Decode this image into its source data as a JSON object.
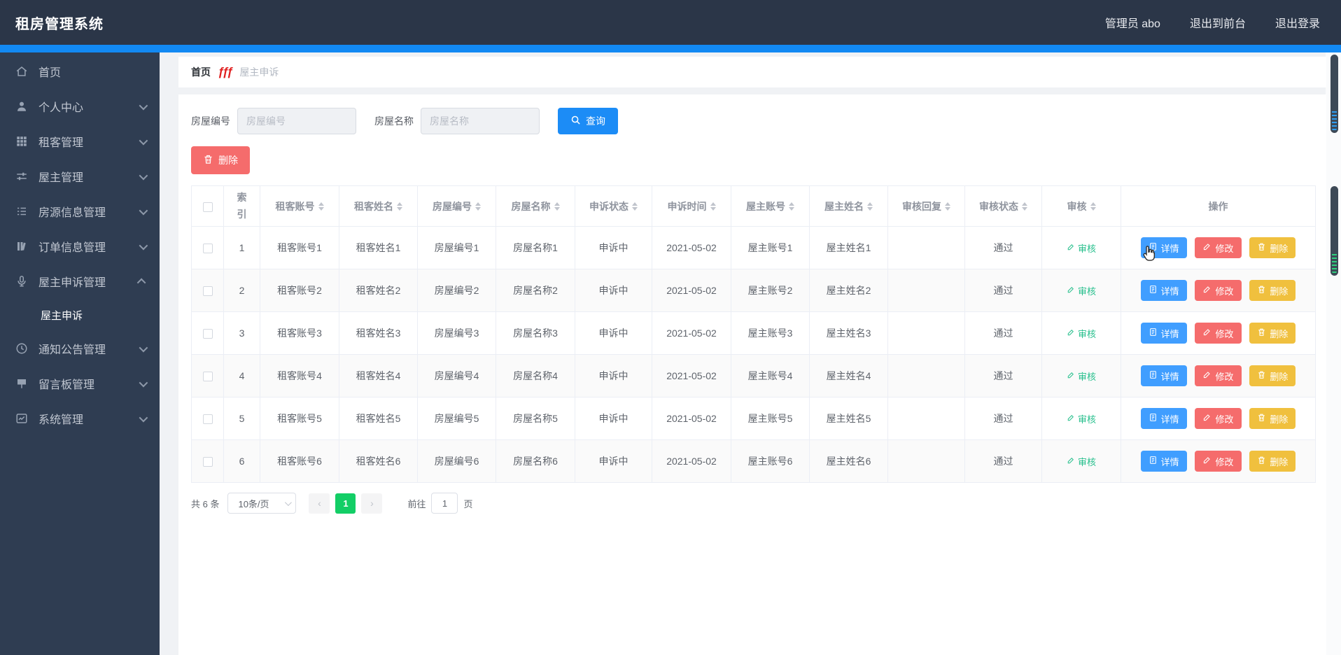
{
  "app": {
    "title": "租房管理系统"
  },
  "navbar": {
    "user": "管理员 abo",
    "links": [
      {
        "label": "退出到前台"
      },
      {
        "label": "退出登录"
      }
    ]
  },
  "sidebar": {
    "items": [
      {
        "label": "首页",
        "icon": "home-icon",
        "arrow": false
      },
      {
        "label": "个人中心",
        "icon": "user-icon",
        "arrow": true
      },
      {
        "label": "租客管理",
        "icon": "grid-icon",
        "arrow": true
      },
      {
        "label": "屋主管理",
        "icon": "sliders-icon",
        "arrow": true
      },
      {
        "label": "房源信息管理",
        "icon": "list-icon",
        "arrow": true
      },
      {
        "label": "订单信息管理",
        "icon": "notebook-icon",
        "arrow": true
      },
      {
        "label": "屋主申诉管理",
        "icon": "microphone-icon",
        "arrow": true,
        "expanded": true
      },
      {
        "label": "屋主申诉",
        "type": "sub",
        "active": true
      },
      {
        "label": "通知公告管理",
        "icon": "clock-icon",
        "arrow": true
      },
      {
        "label": "留言板管理",
        "icon": "message-icon",
        "arrow": true
      },
      {
        "label": "系统管理",
        "icon": "chart-icon",
        "arrow": true
      }
    ]
  },
  "breadcrumb": {
    "home": "首页",
    "separator": "ƒƒƒ",
    "current": "屋主申诉"
  },
  "search": {
    "fields": [
      {
        "label": "房屋编号",
        "placeholder": "房屋编号",
        "value": ""
      },
      {
        "label": "房屋名称",
        "placeholder": "房屋名称",
        "value": ""
      }
    ],
    "submit_label": "查询"
  },
  "toolbar": {
    "delete_label": "删除"
  },
  "table": {
    "columns": [
      {
        "label": "索引",
        "sortable": false
      },
      {
        "label": "租客账号",
        "sortable": true
      },
      {
        "label": "租客姓名",
        "sortable": true
      },
      {
        "label": "房屋编号",
        "sortable": true
      },
      {
        "label": "房屋名称",
        "sortable": true
      },
      {
        "label": "申诉状态",
        "sortable": true
      },
      {
        "label": "申诉时间",
        "sortable": true
      },
      {
        "label": "屋主账号",
        "sortable": true
      },
      {
        "label": "屋主姓名",
        "sortable": true
      },
      {
        "label": "审核回复",
        "sortable": true
      },
      {
        "label": "审核状态",
        "sortable": true
      },
      {
        "label": "审核",
        "sortable": true
      },
      {
        "label": "操作",
        "sortable": false
      }
    ],
    "review_label": "审核",
    "actions": {
      "detail": "详情",
      "edit": "修改",
      "delete": "删除"
    },
    "rows": [
      {
        "cells": [
          "1",
          "租客账号1",
          "租客姓名1",
          "房屋编号1",
          "房屋名称1",
          "申诉中",
          "2021-05-02",
          "屋主账号1",
          "屋主姓名1",
          "",
          "通过"
        ]
      },
      {
        "cells": [
          "2",
          "租客账号2",
          "租客姓名2",
          "房屋编号2",
          "房屋名称2",
          "申诉中",
          "2021-05-02",
          "屋主账号2",
          "屋主姓名2",
          "",
          "通过"
        ]
      },
      {
        "cells": [
          "3",
          "租客账号3",
          "租客姓名3",
          "房屋编号3",
          "房屋名称3",
          "申诉中",
          "2021-05-02",
          "屋主账号3",
          "屋主姓名3",
          "",
          "通过"
        ]
      },
      {
        "cells": [
          "4",
          "租客账号4",
          "租客姓名4",
          "房屋编号4",
          "房屋名称4",
          "申诉中",
          "2021-05-02",
          "屋主账号4",
          "屋主姓名4",
          "",
          "通过"
        ]
      },
      {
        "cells": [
          "5",
          "租客账号5",
          "租客姓名5",
          "房屋编号5",
          "房屋名称5",
          "申诉中",
          "2021-05-02",
          "屋主账号5",
          "屋主姓名5",
          "",
          "通过"
        ]
      },
      {
        "cells": [
          "6",
          "租客账号6",
          "租客姓名6",
          "房屋编号6",
          "房屋名称6",
          "申诉中",
          "2021-05-02",
          "屋主账号6",
          "屋主姓名6",
          "",
          "通过"
        ]
      }
    ]
  },
  "pagination": {
    "total": "共 6 条",
    "page_size": "10条/页",
    "current_page": "1",
    "goto_prefix": "前往",
    "goto_value": "1",
    "goto_suffix": "页"
  },
  "colors": {
    "topbar_bg": "#2b3648",
    "sidebar_bg": "#2f3d52",
    "accent_bar": "#1289f3",
    "primary_blue": "#409eff",
    "danger_red": "#f56c6c",
    "warning_yellow": "#f0c03e",
    "success_green": "#13ce66",
    "review_green": "#26bf8c"
  }
}
